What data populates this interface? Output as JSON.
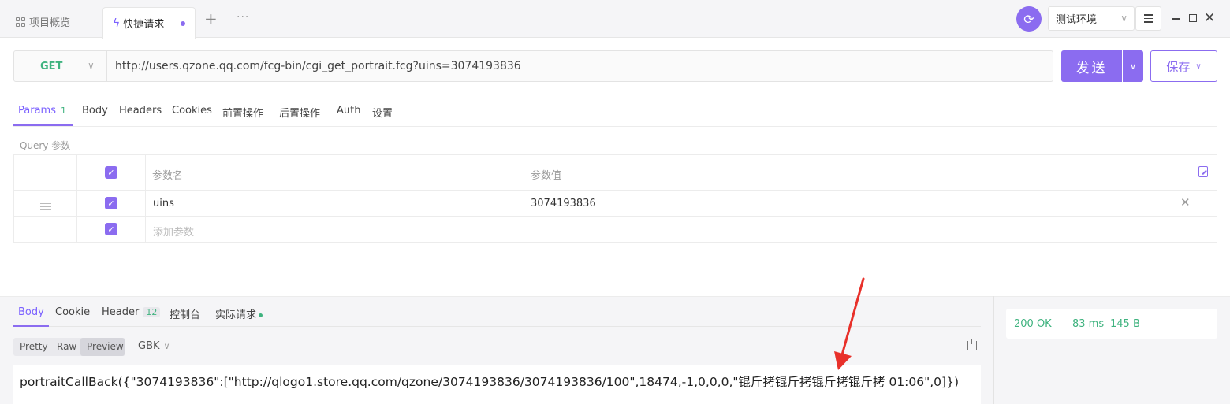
{
  "tabs": {
    "overview_label": "项目概览",
    "active_label": "快捷请求",
    "add_label": "+",
    "more_label": "···"
  },
  "env": {
    "selected": "测试环境"
  },
  "request": {
    "method": "GET",
    "url": "http://users.qzone.qq.com/fcg-bin/cgi_get_portrait.fcg?uins=3074193836",
    "send_label": "发送",
    "save_label": "保存"
  },
  "param_tabs": [
    {
      "label": "Params",
      "count": "1"
    },
    {
      "label": "Body"
    },
    {
      "label": "Headers"
    },
    {
      "label": "Cookies"
    },
    {
      "label": "前置操作"
    },
    {
      "label": "后置操作"
    },
    {
      "label": "Auth"
    },
    {
      "label": "设置"
    }
  ],
  "query_label": "Query 参数",
  "params_table": {
    "name_header": "参数名",
    "value_header": "参数值",
    "rows": [
      {
        "name": "uins",
        "value": "3074193836"
      }
    ],
    "add_placeholder": "添加参数"
  },
  "response": {
    "tabs": [
      {
        "label": "Body"
      },
      {
        "label": "Cookie"
      },
      {
        "label": "Header",
        "count": "12"
      },
      {
        "label": "控制台"
      },
      {
        "label": "实际请求"
      }
    ],
    "views": [
      "Pretty",
      "Raw",
      "Preview"
    ],
    "active_view": "Preview",
    "encoding": "GBK",
    "body": "portraitCallBack({\"3074193836\":[\"http://qlogo1.store.qq.com/qzone/3074193836/3074193836/100\",18474,-1,0,0,0,\"锟斤拷锟斤拷锟斤拷锟斤拷 01:06\",0]})",
    "status": "200 OK",
    "time": "83 ms",
    "size": "145 B"
  },
  "colors": {
    "accent": "#8b6cf0",
    "success": "#3fb37f",
    "annotation": "#e8302a"
  }
}
